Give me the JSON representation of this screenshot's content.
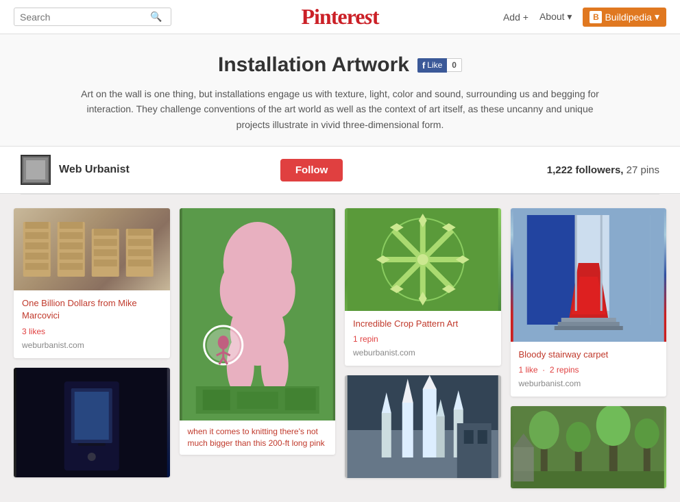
{
  "header": {
    "search_placeholder": "Search",
    "logo": "Pinterest",
    "add_label": "Add +",
    "about_label": "About ▾",
    "buildipedia_label": "Buildipedia",
    "buildipedia_icon": "B"
  },
  "hero": {
    "title": "Installation Artwork",
    "fb_like": "Like",
    "fb_count": "0",
    "description": "Art on the wall is one thing, but installations engage us with texture, light, color and sound, surrounding us and begging for interaction. They challenge conventions of the art world as well as the context of art itself, as these uncanny and unique projects illustrate in vivid three-dimensional form."
  },
  "profile": {
    "name": "Web Urbanist",
    "follow_label": "Follow",
    "followers_text": "1,222 followers, 27 pins"
  },
  "pins": {
    "columns": [
      {
        "id": "col1",
        "items": [
          {
            "id": "pin1",
            "title": "One Billion Dollars from Mike Marcovici",
            "likes": "3 likes",
            "source": "weburbanist.com",
            "image_type": "pallets"
          },
          {
            "id": "pin2",
            "image_type": "dark",
            "title": "",
            "likes": "",
            "source": ""
          }
        ]
      },
      {
        "id": "col2",
        "items": [
          {
            "id": "pin3",
            "image_type": "pink_sculpture",
            "caption": "when it comes to knitting there's not much bigger than this 200-ft long pink"
          }
        ]
      },
      {
        "id": "col3",
        "items": [
          {
            "id": "pin4",
            "title": "Incredible Crop Pattern Art",
            "likes": "1 repin",
            "source": "weburbanist.com",
            "image_type": "crop"
          },
          {
            "id": "pin5",
            "image_type": "cathedral",
            "title": "",
            "likes": "",
            "source": ""
          }
        ]
      },
      {
        "id": "col4",
        "items": [
          {
            "id": "pin6",
            "title": "Bloody stairway carpet",
            "likes": "1 like · 2 repins",
            "source": "weburbanist.com",
            "image_type": "red_carpet"
          },
          {
            "id": "pin7",
            "image_type": "trees",
            "title": "",
            "likes": "",
            "source": ""
          }
        ]
      }
    ]
  }
}
